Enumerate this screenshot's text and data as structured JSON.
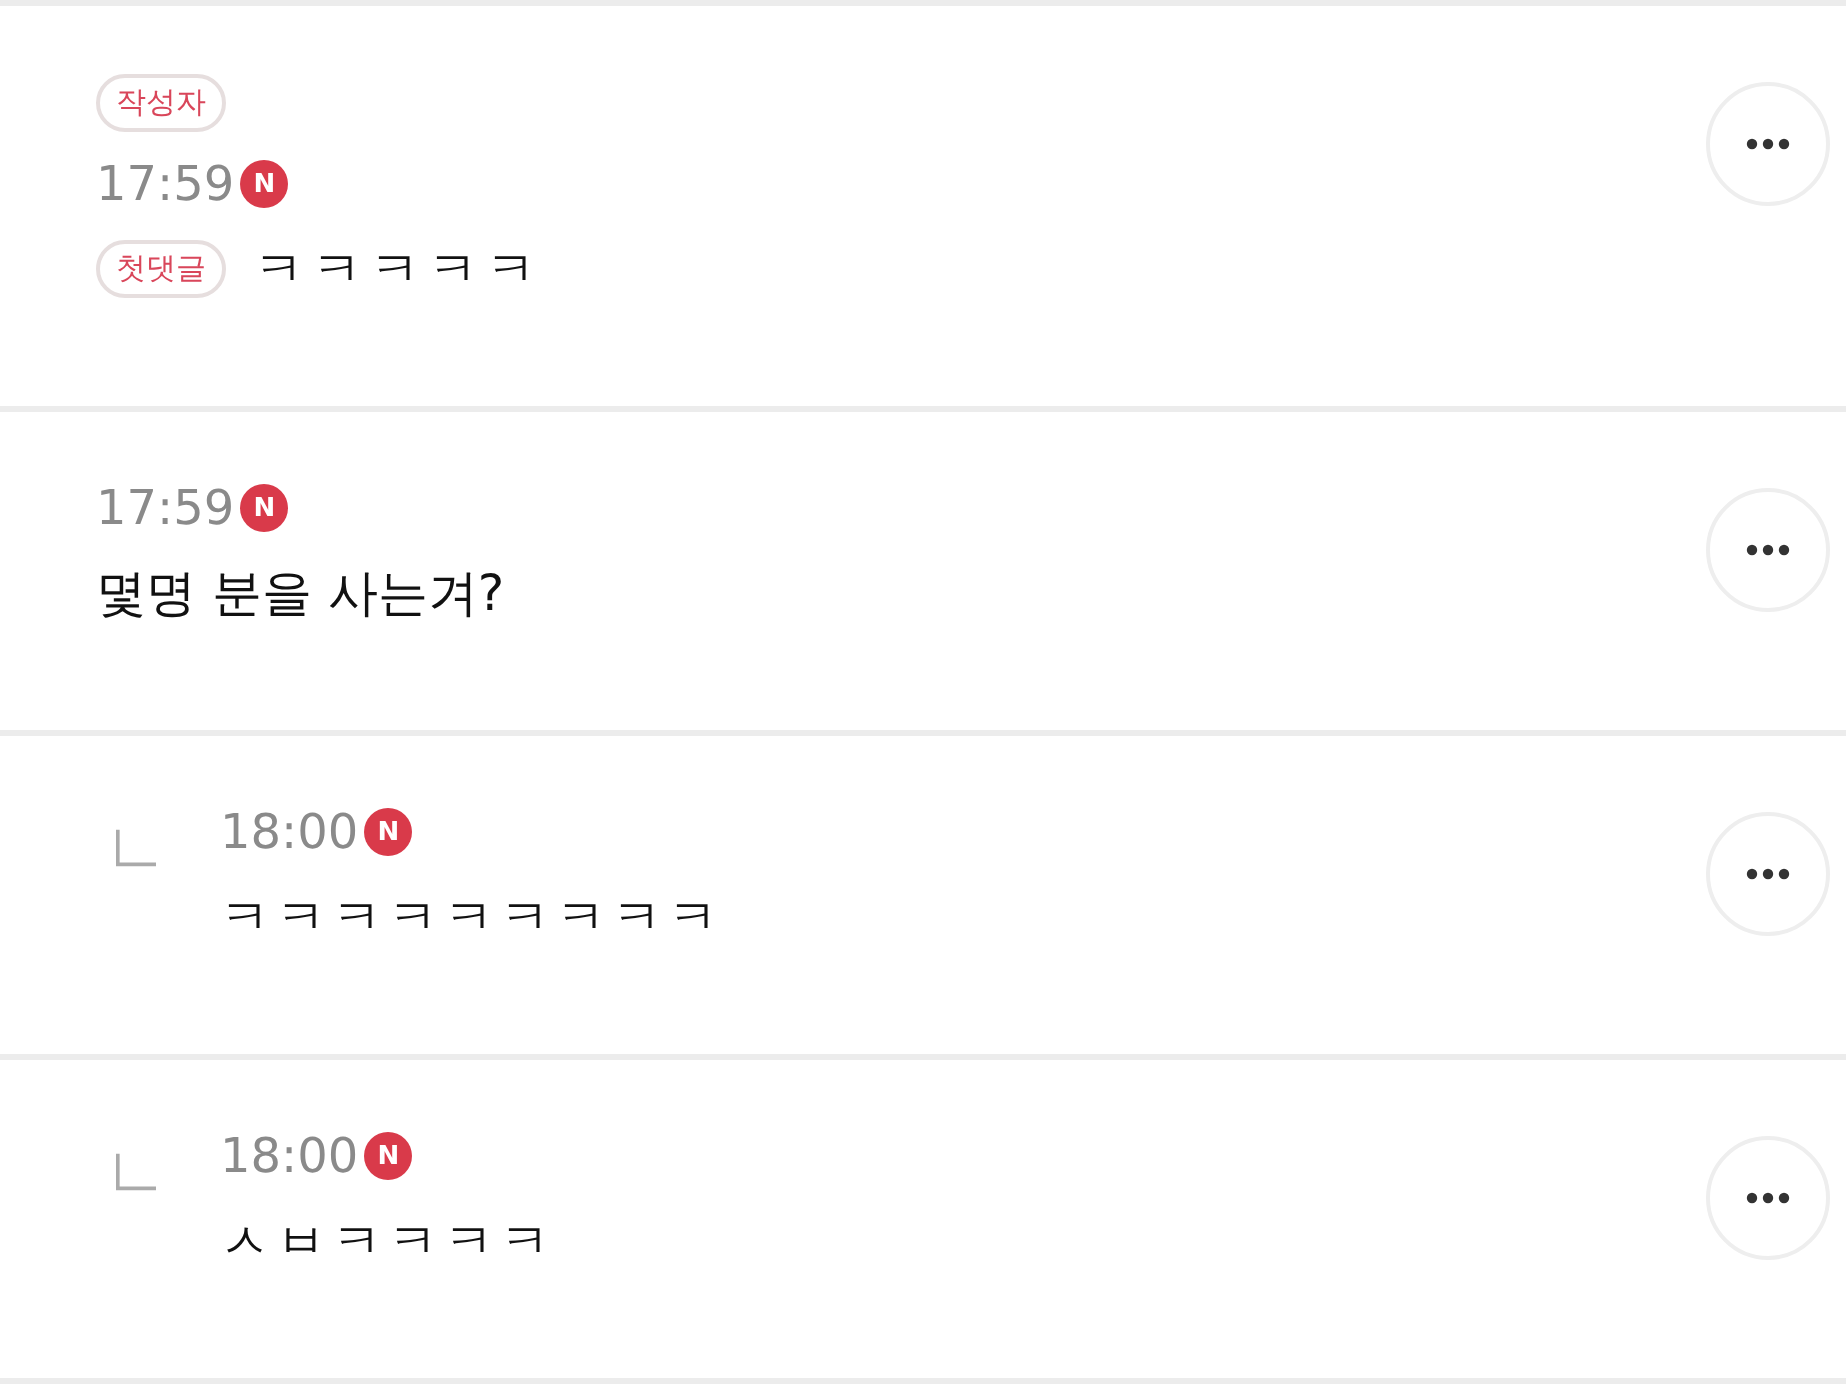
{
  "comments": [
    {
      "kind": "comment",
      "author_tag": "작성자",
      "time": "17:59",
      "new_badge": "N",
      "body_tag": "첫댓글",
      "text": "ㅋㅋㅋㅋㅋ"
    },
    {
      "kind": "comment",
      "time": "17:59",
      "new_badge": "N",
      "text": "몇명 분을 사는겨?"
    },
    {
      "kind": "reply",
      "time": "18:00",
      "new_badge": "N",
      "text": "ㅋㅋㅋㅋㅋㅋㅋㅋㅋ"
    },
    {
      "kind": "reply",
      "time": "18:00",
      "new_badge": "N",
      "text": "ㅅㅂㅋㅋㅋㅋ"
    }
  ]
}
